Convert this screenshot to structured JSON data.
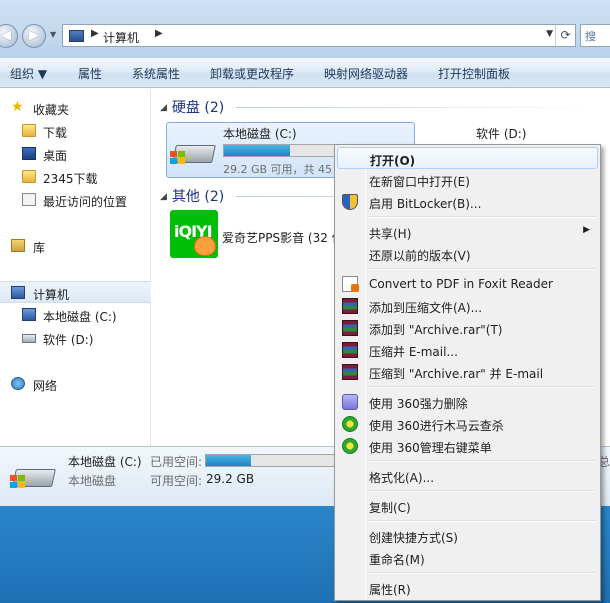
{
  "address": {
    "crumb": "计算机",
    "search_icon": "search-icon"
  },
  "toolbar": {
    "organize": "组织 ▼",
    "properties": "属性",
    "system_properties": "系统属性",
    "uninstall": "卸载或更改程序",
    "map_drive": "映射网络驱动器",
    "control_panel": "打开控制面板"
  },
  "nav": {
    "favorites": "收藏夹",
    "downloads": "下载",
    "desktop": "桌面",
    "downloads2345": "2345下载",
    "recent": "最近访问的位置",
    "libraries": "库",
    "computer": "计算机",
    "local_disk": "本地磁盘 (C:)",
    "software": "软件 (D:)",
    "network": "网络"
  },
  "content": {
    "group_hdd": "硬盘 (2)",
    "group_other": "其他 (2)",
    "drive_c_name": "本地磁盘 (C:)",
    "drive_c_free": "29.2 GB 可用，共 45",
    "drive_c_used_fraction": 0.35,
    "drive_d_name": "软件 (D:)",
    "app_name": "爱奇艺PPS影音 (32 位)",
    "app_logo_text": "iQIYI"
  },
  "details": {
    "name": "本地磁盘 (C:)",
    "type": "本地磁盘",
    "used_label": "已用空间:",
    "free_label": "可用空间:",
    "free_value": "29.2 GB",
    "used_fraction": 0.35,
    "trailing": "总"
  },
  "menu": {
    "open": "打开(O)",
    "open_new_window": "在新窗口中打开(E)",
    "bitlocker": "启用 BitLocker(B)...",
    "share": "共享(H)",
    "restore": "还原以前的版本(V)",
    "foxit": "Convert to PDF in Foxit Reader",
    "add_archive": "添加到压缩文件(A)...",
    "add_rar": "添加到 \"Archive.rar\"(T)",
    "compress_email": "压缩并 E-mail...",
    "compress_rar_email": "压缩到 \"Archive.rar\" 并 E-mail",
    "del_360": "使用 360强力删除",
    "scan_360": "使用 360进行木马云查杀",
    "manage_360": "使用 360管理右键菜单",
    "format": "格式化(A)...",
    "copy": "复制(C)",
    "shortcut": "创建快捷方式(S)",
    "rename": "重命名(M)",
    "properties": "属性(R)"
  }
}
